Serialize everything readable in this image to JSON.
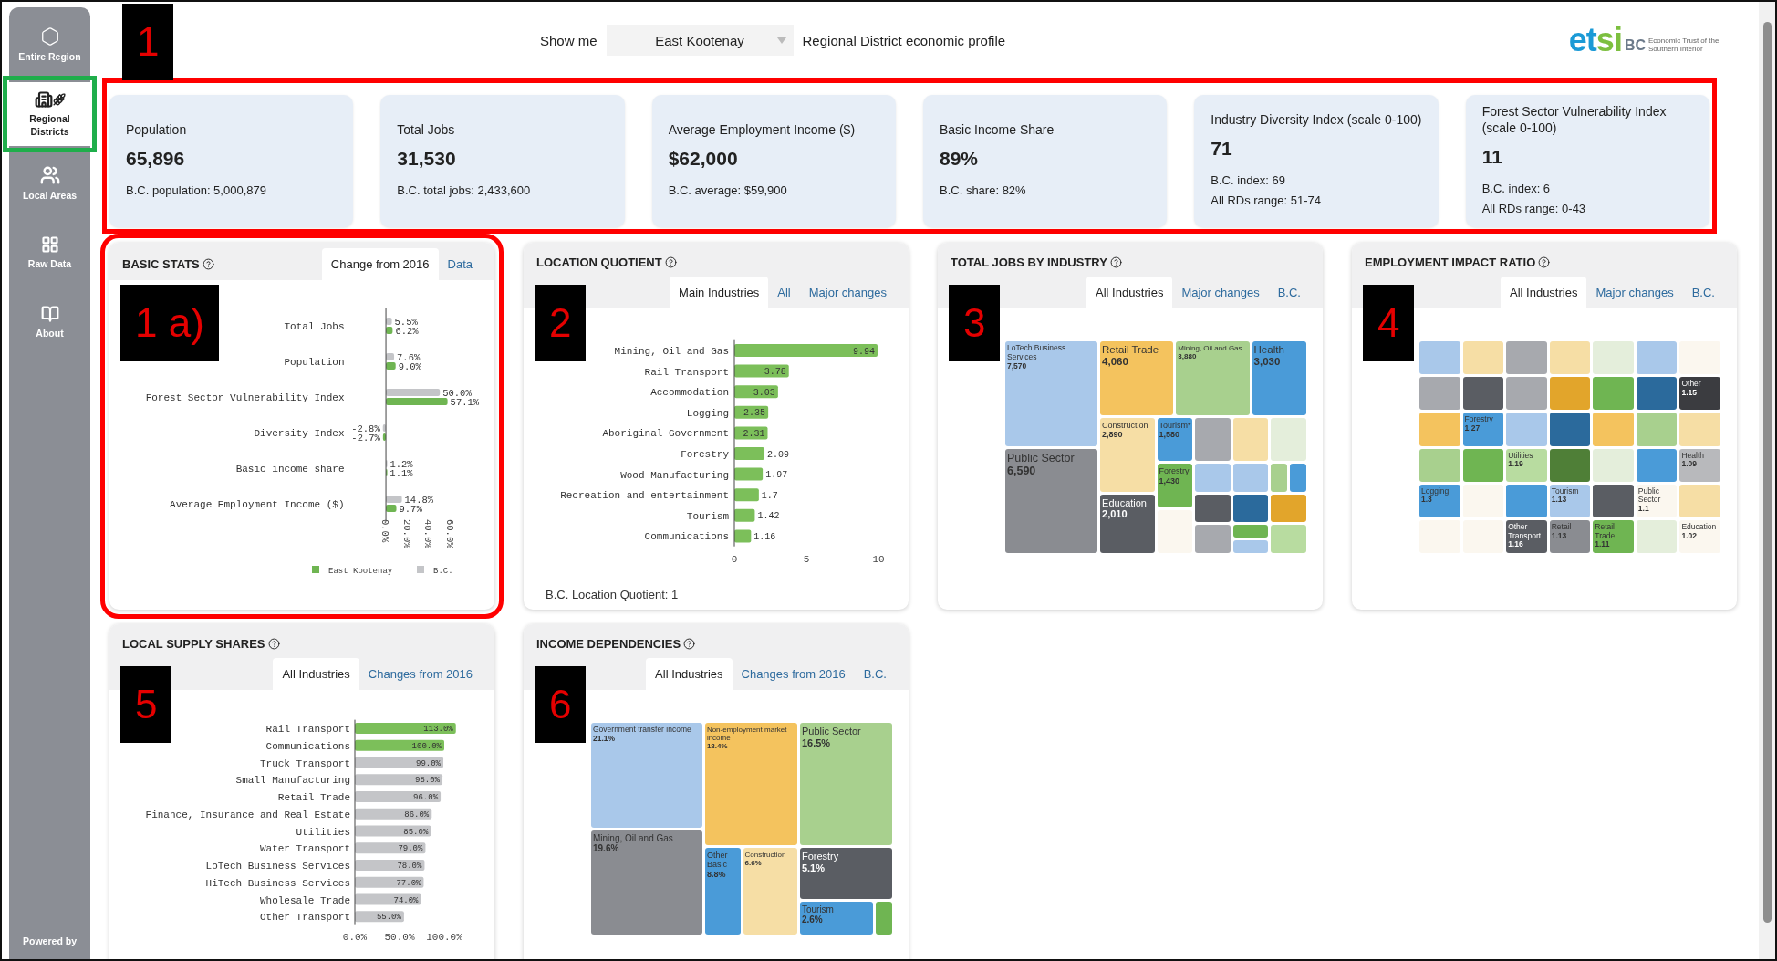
{
  "sidebar": {
    "items": [
      {
        "label": "Entire Region",
        "selected": false,
        "outlined": false
      },
      {
        "label": "Regional Districts",
        "selected": true,
        "outlined": true
      },
      {
        "label": "Local Areas",
        "selected": false,
        "outlined": false
      },
      {
        "label": "Raw Data",
        "selected": false,
        "outlined": false
      },
      {
        "label": "About",
        "selected": false,
        "outlined": false
      }
    ],
    "footer": "Powered by"
  },
  "header": {
    "callout": "1",
    "show_me": "Show me",
    "district": "East Kootenay",
    "suffix": "Regional District economic profile",
    "logo": {
      "mark": "etsi",
      "suffix": "BC",
      "tagline": "Economic Trust of the Southern Interior"
    }
  },
  "kpis": {
    "outlined": true,
    "cards": [
      {
        "label": "Population",
        "value": "65,896",
        "notes": [
          "B.C. population: 5,000,879"
        ]
      },
      {
        "label": "Total Jobs",
        "value": "31,530",
        "notes": [
          "B.C. total jobs: 2,433,600"
        ]
      },
      {
        "label": "Average Employment Income ($)",
        "value": "$62,000",
        "notes": [
          "B.C. average: $59,900"
        ]
      },
      {
        "label": "Basic Income Share",
        "value": "89%",
        "notes": [
          "B.C. share: 82%"
        ]
      },
      {
        "label": "Industry Diversity Index (scale 0-100)",
        "value": "71",
        "notes": [
          "B.C. index: 69",
          "All RDs range: 51-74"
        ]
      },
      {
        "label": "Forest Sector Vulnerability Index (scale 0-100)",
        "value": "11",
        "notes": [
          "B.C. index: 6",
          "All RDs range: 0-43"
        ]
      }
    ]
  },
  "panels": [
    {
      "kind": "grouped-bars",
      "title": "BASIC STATS",
      "callout": "1 a)",
      "outlined": true,
      "tabs": [
        {
          "label": "Change from 2016",
          "selected": true
        },
        {
          "label": "Data",
          "selected": false
        }
      ],
      "chart_data": {
        "type": "bar",
        "orientation": "horizontal",
        "legend": "bottom",
        "categories": [
          "Total Jobs",
          "Population",
          "Forest Sector Vulnerability Index",
          "Diversity Index",
          "Basic income share",
          "Average Employment Income ($)"
        ],
        "xlim": [
          -3,
          62
        ],
        "xticks": [
          {
            "value": 0,
            "label": "0.0%"
          },
          {
            "value": 20,
            "label": "20.0%"
          },
          {
            "value": 40,
            "label": "40.0%"
          },
          {
            "value": 60,
            "label": "60.0%"
          }
        ],
        "series": [
          {
            "name": "B.C.",
            "color": "#c4c5c8",
            "values": [
              5.5,
              7.6,
              50.0,
              -2.8,
              1.2,
              14.8
            ],
            "value_labels": [
              "5.5%",
              "7.6%",
              "50.0%",
              "-2.8%",
              "1.2%",
              "14.8%"
            ]
          },
          {
            "name": "East Kootenay",
            "color": "#6fb552",
            "values": [
              6.2,
              9.0,
              57.1,
              -2.7,
              1.1,
              9.7
            ],
            "value_labels": [
              "6.2%",
              "9.0%",
              "57.1%",
              "-2.7%",
              "1.1%",
              "9.7%"
            ]
          }
        ]
      }
    },
    {
      "kind": "bars",
      "title": "LOCATION QUOTIENT",
      "callout": "2",
      "outlined": false,
      "tabs": [
        {
          "label": "Main Industries",
          "selected": true
        },
        {
          "label": "All",
          "selected": false
        },
        {
          "label": "Major changes",
          "selected": false
        }
      ],
      "chart_data": {
        "type": "bar",
        "orientation": "horizontal",
        "categories": [
          "Mining, Oil and Gas",
          "Rail Transport",
          "Accommodation",
          "Logging",
          "Aboriginal Government",
          "Forestry",
          "Wood Manufacturing",
          "Recreation and entertainment",
          "Tourism",
          "Communications"
        ],
        "xlim": [
          0,
          10
        ],
        "xticks": [
          0,
          5,
          10
        ],
        "series": [
          {
            "color": "#7cbf5a",
            "values": [
              9.94,
              3.78,
              3.03,
              2.35,
              2.31,
              2.09,
              1.97,
              1.7,
              1.42,
              1.16
            ],
            "value_labels": [
              "9.94",
              "3.78",
              "3.03",
              "2.35",
              "2.31",
              "2.09",
              "1.97",
              "1.7",
              "1.42",
              "1.16"
            ]
          }
        ]
      },
      "note": "B.C. Location Quotient: 1"
    },
    {
      "kind": "treemap",
      "title": "TOTAL JOBS BY INDUSTRY",
      "callout": "3",
      "outlined": false,
      "tabs": [
        {
          "label": "All Industries",
          "selected": true
        },
        {
          "label": "Major changes",
          "selected": false
        },
        {
          "label": "B.C.",
          "selected": false
        }
      ],
      "tiles": [
        {
          "label": "LoTech Business Services",
          "value": "7,570",
          "color": "#a9c8ea"
        },
        {
          "label": "Retail Trade",
          "value": "4,060",
          "color": "#f4c35e"
        },
        {
          "label": "Mining, Oil and Gas",
          "value": "3,880",
          "color": "#a8d08e"
        },
        {
          "label": "Health",
          "value": "3,030",
          "color": "#4a9bd8"
        },
        {
          "label": "Public Sector",
          "value": "6,590",
          "color": "#8a8c91"
        },
        {
          "label": "Construction",
          "value": "2,890",
          "color": "#f6dea5"
        },
        {
          "label": "Education",
          "value": "2,010",
          "color": "#5a5d63"
        },
        {
          "label": "Tourism*",
          "value": "1,580",
          "color": "#4a9bd8"
        },
        {
          "label": "Forestry",
          "value": "1,430",
          "color": "#6fb552"
        },
        {
          "color": "#a8d08e"
        },
        {
          "color": "#a7a9ae"
        },
        {
          "color": "#f6dea5"
        },
        {
          "color": "#e4eedb"
        },
        {
          "color": "#a9c8ea"
        },
        {
          "color": "#a9c8ea"
        },
        {
          "color": "#4a9bd8"
        },
        {
          "color": "#5a5d63"
        },
        {
          "color": "#2b6a9c"
        },
        {
          "color": "#e2a52b"
        },
        {
          "color": "#a7a9ae"
        },
        {
          "color": "#6fb552"
        },
        {
          "color": "#a9c8ea"
        },
        {
          "color": "#b8dca0"
        },
        {
          "color": "#fbf7ef"
        }
      ]
    },
    {
      "kind": "treemap",
      "title": "EMPLOYMENT IMPACT RATIO",
      "callout": "4",
      "outlined": false,
      "tabs": [
        {
          "label": "All Industries",
          "selected": true
        },
        {
          "label": "Major changes",
          "selected": false
        },
        {
          "label": "B.C.",
          "selected": false
        }
      ],
      "tiles": [
        {
          "color": "#a9c8ea"
        },
        {
          "color": "#f6dea5"
        },
        {
          "color": "#a7a9ae"
        },
        {
          "color": "#f6dea5"
        },
        {
          "color": "#e4eedb"
        },
        {
          "color": "#a9c8ea"
        },
        {
          "color": "#fbf7ef"
        },
        {
          "color": "#a7a9ae"
        },
        {
          "color": "#5a5d63"
        },
        {
          "color": "#a7a9ae"
        },
        {
          "color": "#e2a52b"
        },
        {
          "color": "#6fb552"
        },
        {
          "color": "#2b6a9c"
        },
        {
          "label": "Other",
          "value": "1.15",
          "color": "#3b3c40"
        },
        {
          "color": "#f4c35e"
        },
        {
          "label": "Forestry",
          "value": "1.27",
          "color": "#4a9bd8"
        },
        {
          "color": "#a9c8ea"
        },
        {
          "color": "#2b6a9c"
        },
        {
          "color": "#f4c35e"
        },
        {
          "color": "#a8d08e"
        },
        {
          "color": "#f6dea5"
        },
        {
          "color": "#a8d08e"
        },
        {
          "color": "#6fb552"
        },
        {
          "label": "Utilities",
          "value": "1.19",
          "color": "#b8dca0"
        },
        {
          "color": "#4f7f37"
        },
        {
          "color": "#e4eedb"
        },
        {
          "color": "#4a9bd8"
        },
        {
          "label": "Health",
          "value": "1.09",
          "color": "#b8b9bc"
        },
        {
          "label": "Logging",
          "value": "1.3",
          "color": "#4a9bd8"
        },
        {
          "color": "#fbf7ef"
        },
        {
          "color": "#4a9bd8"
        },
        {
          "label": "Tourism",
          "value": "1.13",
          "color": "#a9c8ea"
        },
        {
          "color": "#5a5d63"
        },
        {
          "label": "Public Sector",
          "value": "1.1",
          "color": "#fbf7ef"
        },
        {
          "color": "#f6dea5"
        },
        {
          "color": "#fbf7ef"
        },
        {
          "color": "#fbf7ef"
        },
        {
          "label": "Other Transport",
          "value": "1.16",
          "color": "#5a5d63"
        },
        {
          "label": "Retail",
          "value": "1.13",
          "color": "#8a8c91"
        },
        {
          "label": "Retail Trade",
          "value": "1.11",
          "color": "#6fb552"
        },
        {
          "color": "#e4eedb"
        },
        {
          "label": "Education",
          "value": "1.02",
          "color": "#fbf7ef"
        }
      ]
    },
    {
      "kind": "bars",
      "title": "LOCAL SUPPLY SHARES",
      "callout": "5",
      "outlined": false,
      "tabs": [
        {
          "label": "All Industries",
          "selected": true
        },
        {
          "label": "Changes from 2016",
          "selected": false
        }
      ],
      "chart_data": {
        "type": "bar",
        "orientation": "horizontal",
        "stacked": true,
        "categories": [
          "Rail Transport",
          "Communications",
          "Truck Transport",
          "Small Manufacturing",
          "Retail Trade",
          "Finance, Insurance and Real Estate",
          "Utilities",
          "Water Transport",
          "LoTech Business Services",
          "HiTech Business Services",
          "Wholesale Trade",
          "Other Transport"
        ],
        "xlim": [
          0,
          115
        ],
        "xticks": [
          {
            "value": 0,
            "label": "0.0%"
          },
          {
            "value": 50,
            "label": "50.0%"
          },
          {
            "value": 100,
            "label": "100.0%"
          }
        ],
        "series": [
          {
            "color": "#7cbf5a",
            "values": [
              113.0,
              100.0,
              null,
              null,
              null,
              null,
              null,
              null,
              null,
              null,
              null,
              null
            ],
            "value_labels": [
              "113.0%",
              "100.0%",
              null,
              null,
              null,
              null,
              null,
              null,
              null,
              null,
              null,
              null
            ]
          },
          {
            "color": "#c4c5c8",
            "values": [
              null,
              null,
              99.0,
              98.0,
              96.0,
              86.0,
              85.0,
              79.0,
              78.0,
              77.0,
              74.0,
              55.0
            ],
            "value_labels": [
              null,
              null,
              "99.0%",
              "98.0%",
              "96.0%",
              "86.0%",
              "85.0%",
              "79.0%",
              "78.0%",
              "77.0%",
              "74.0%",
              "55.0%"
            ]
          }
        ]
      }
    },
    {
      "kind": "treemap",
      "title": "INCOME DEPENDENCIES",
      "callout": "6",
      "outlined": false,
      "tabs": [
        {
          "label": "All Industries",
          "selected": true
        },
        {
          "label": "Changes from 2016",
          "selected": false
        },
        {
          "label": "B.C.",
          "selected": false
        }
      ],
      "tiles": [
        {
          "label": "Government transfer income",
          "value": "21.1%",
          "color": "#a9c8ea"
        },
        {
          "label": "Non-employment market income",
          "value": "18.4%",
          "color": "#f4c35e"
        },
        {
          "label": "Public Sector",
          "value": "16.5%",
          "color": "#a8d08e"
        },
        {
          "label": "Mining, Oil and Gas",
          "value": "19.6%",
          "color": "#8a8c91"
        },
        {
          "label": "Other Basic",
          "value": "8.8%",
          "color": "#4a9bd8"
        },
        {
          "label": "Construction",
          "value": "6.6%",
          "color": "#f6dea5"
        },
        {
          "label": "Forestry",
          "value": "5.1%",
          "color": "#5a5d63"
        },
        {
          "label": "Tourism",
          "value": "2.6%",
          "color": "#4a9bd8"
        },
        {
          "color": "#6fb552"
        }
      ]
    }
  ]
}
